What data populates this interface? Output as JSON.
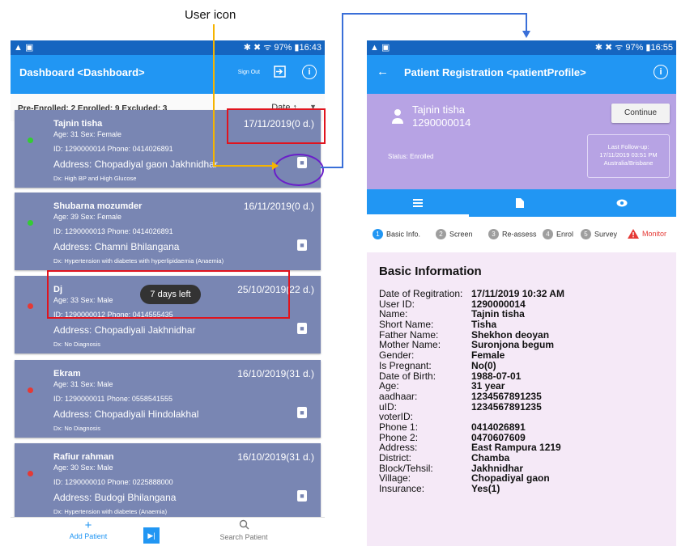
{
  "annotation": {
    "user_icon_label": "User icon"
  },
  "left_phone": {
    "status_bar": {
      "left": "▲ ▣",
      "right": "✱ ✖ ᯤ 97% ▮16:43"
    },
    "app_bar": {
      "title": "Dashboard <Dashboard>",
      "sign_out": "Sign Out",
      "sign_out_icon": "logout-icon",
      "info_icon": "info-icon"
    },
    "filter": {
      "counts": "Pre-Enrolled: 2 Enrolled: 9 Excluded: 3",
      "sort_label": "Date ↑"
    },
    "patients": [
      {
        "name": "Tajnin tisha",
        "date": "17/11/2019(0 d.)",
        "age_sex": "Age: 31   Sex: Female",
        "id_phone": "ID: 1290000014   Phone: 0414026891",
        "address": "Address: Chopadiyal gaon Jakhnidhar",
        "dx": "Dx: High BP and High Glucose",
        "status_color": "#33cc33"
      },
      {
        "name": "Shubarna mozumder",
        "date": "16/11/2019(0 d.)",
        "age_sex": "Age: 39   Sex: Female",
        "id_phone": "ID: 1290000013   Phone: 0414026891",
        "address": "Address: Chamni Bhilangana",
        "dx": "Dx: Hypertension with diabetes with hyperlipidaemia (Anaemia)",
        "status_color": "#33cc33"
      },
      {
        "name": "Dj",
        "date": "25/10/2019(22 d.)",
        "age_sex": "Age: 33   Sex: Male",
        "id_phone": "ID: 1290000012   Phone: 0414555435",
        "address": "Address: Chopadiyali Jakhnidhar",
        "dx": "Dx: No Diagnosis",
        "status_color": "#e53935"
      },
      {
        "name": "Ekram",
        "date": "16/10/2019(31 d.)",
        "age_sex": "Age: 31   Sex: Male",
        "id_phone": "ID: 1290000011   Phone: 0558541555",
        "address": "Address: Chopadiyali Hindolakhal",
        "dx": "Dx: No Diagnosis",
        "status_color": "#e53935"
      },
      {
        "name": "Rafiur rahman",
        "date": "16/10/2019(31 d.)",
        "age_sex": "Age: 30   Sex: Male",
        "id_phone": "ID: 1290000010   Phone: 0225888000",
        "address": "Address: Budogi Bhilangana",
        "dx": "Dx: Hypertension with diabetes (Anaemia)",
        "status_color": "#e53935"
      }
    ],
    "toast": "7 days left",
    "bottom_nav": {
      "add_patient": "Add Patient",
      "search_patient": "Search Patient"
    }
  },
  "right_phone": {
    "status_bar": {
      "left": "▲ ▣",
      "right": "✱ ✖ ᯤ 97% ▮16:55"
    },
    "app_bar": {
      "title": "Patient Registration <patientProfile>"
    },
    "profile": {
      "name": "Tajnin tisha",
      "id": "1290000014",
      "status": "Status: Enrolled",
      "continue": "Continue",
      "last_followup": {
        "label": "Last Follow-up:",
        "datetime": "17/11/2019 03:51 PM",
        "timezone": "Australia/Brisbane"
      }
    },
    "stepper": [
      {
        "num": "1",
        "label": "Basic Info."
      },
      {
        "num": "2",
        "label": "Screen"
      },
      {
        "num": "3",
        "label": "Re-assess"
      },
      {
        "num": "4",
        "label": "Enrol"
      },
      {
        "num": "5",
        "label": "Survey"
      },
      {
        "num": "",
        "label": "Monitor"
      }
    ],
    "basic_info": {
      "heading": "Basic Information",
      "rows": [
        {
          "k": "Date of Regitration:",
          "v": "17/11/2019 10:32 AM"
        },
        {
          "k": "User ID:",
          "v": "1290000014"
        },
        {
          "k": "Name:",
          "v": "Tajnin tisha"
        },
        {
          "k": "Short Name:",
          "v": "Tisha"
        },
        {
          "k": "Father Name:",
          "v": "Shekhon deoyan"
        },
        {
          "k": "Mother Name:",
          "v": "Suronjona begum"
        },
        {
          "k": "Gender:",
          "v": "Female"
        },
        {
          "k": "Is Pregnant:",
          "v": "No(0)"
        },
        {
          "k": "Date of Birth:",
          "v": "1988-07-01"
        },
        {
          "k": "Age:",
          "v": "31 year"
        },
        {
          "k": "aadhaar:",
          "v": "1234567891235"
        },
        {
          "k": "uID:",
          "v": "1234567891235"
        },
        {
          "k": "voterID:",
          "v": ""
        },
        {
          "k": "Phone 1:",
          "v": "0414026891"
        },
        {
          "k": "Phone 2:",
          "v": "0470607609"
        },
        {
          "k": "Address:",
          "v": "East Rampura 1219"
        },
        {
          "k": "District:",
          "v": "Chamba"
        },
        {
          "k": "Block/Tehsil:",
          "v": "Jakhnidhar"
        },
        {
          "k": "Village:",
          "v": "Chopadiyal gaon"
        },
        {
          "k": "Insurance:",
          "v": "Yes(1)"
        }
      ]
    }
  }
}
